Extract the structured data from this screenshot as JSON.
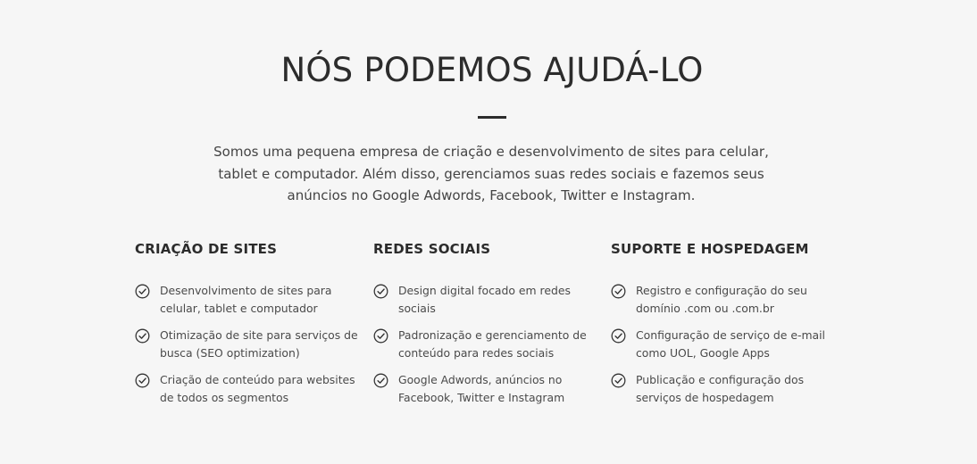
{
  "section": {
    "title": "NÓS PODEMOS AJUDÁ-LO",
    "intro": "Somos uma pequena empresa de criação e desenvolvimento de sites para celular, tablet e computador. Além disso, gerenciamos suas redes sociais e fazemos seus anúncios no Google Adwords, Facebook, Twitter e Instagram."
  },
  "columns": [
    {
      "title": "CRIAÇÃO DE SITES",
      "items": [
        {
          "icon": "check-circle-icon",
          "text": "Desenvolvimento de sites para celular, tablet e computador"
        },
        {
          "icon": "check-circle-icon",
          "text": "Otimização de site para serviços de busca (SEO optimization)"
        },
        {
          "icon": "check-circle-icon",
          "text": "Criação de conteúdo para websites de todos os segmentos"
        }
      ]
    },
    {
      "title": "REDES SOCIAIS",
      "items": [
        {
          "icon": "check-circle-icon",
          "text": "Design digital focado em redes sociais"
        },
        {
          "icon": "check-circle-icon",
          "text": "Padronização e gerenciamento de conteúdo para redes sociais"
        },
        {
          "icon": "check-circle-icon",
          "text": "Google Adwords, anúncios no Facebook, Twitter e Instagram"
        }
      ]
    },
    {
      "title": "SUPORTE E HOSPEDAGEM",
      "items": [
        {
          "icon": "check-circle-icon",
          "text": "Registro e configuração do seu domínio .com ou .com.br"
        },
        {
          "icon": "check-circle-icon",
          "text": "Configuração de serviço de e-mail como UOL, Google Apps"
        },
        {
          "icon": "check-circle-icon",
          "text": "Publicação e configuração dos serviços de hospedagem"
        }
      ]
    }
  ],
  "colors": {
    "background": "#f6f6f6",
    "heading": "#2c2c2c",
    "text": "#4a4a4a"
  }
}
